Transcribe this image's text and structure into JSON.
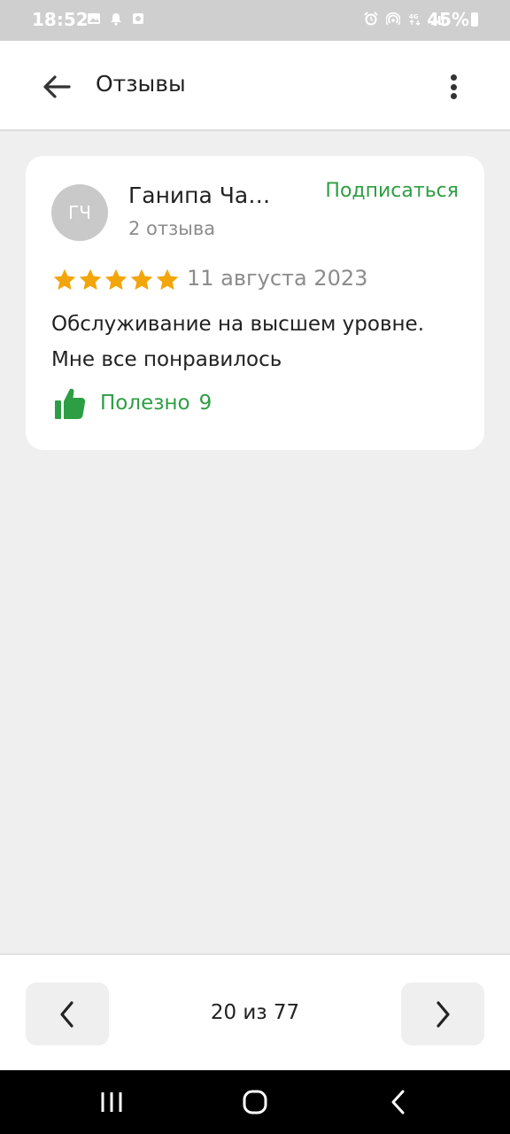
{
  "status_bar": {
    "time": "18:52",
    "battery": "45%",
    "left_icons": [
      "image-icon",
      "notification-bell-icon",
      "app-notification-icon"
    ],
    "right_icons": [
      "alarm-icon",
      "hotspot-icon",
      "4g-data-icon",
      "signal-icon",
      "battery-icon"
    ]
  },
  "header": {
    "title": "Отзывы",
    "back_icon": "arrow-left-icon",
    "menu_icon": "more-vertical-icon"
  },
  "review": {
    "avatar_initials": "ГЧ",
    "author": "Ганипа Ча…",
    "reviews_count": "2 отзыва",
    "subscribe_label": "Подписаться",
    "rating": 5,
    "rating_max": 5,
    "date": "11 августа 2023",
    "text": "Обслуживание на высшем уровне. Мне все понравилось",
    "helpful_label": "Полезно",
    "helpful_count": "9",
    "helpful_icon": "thumbs-up-icon"
  },
  "pager": {
    "text": "20 из 77",
    "prev_icon": "chevron-left-icon",
    "next_icon": "chevron-right-icon"
  },
  "nav_bar": {
    "icons": [
      "recents-icon",
      "home-icon",
      "back-icon"
    ]
  },
  "colors": {
    "accent_green": "#2e9e44",
    "star_yellow": "#f2a60c",
    "background": "#efefef",
    "muted_text": "#8c8c8c"
  }
}
